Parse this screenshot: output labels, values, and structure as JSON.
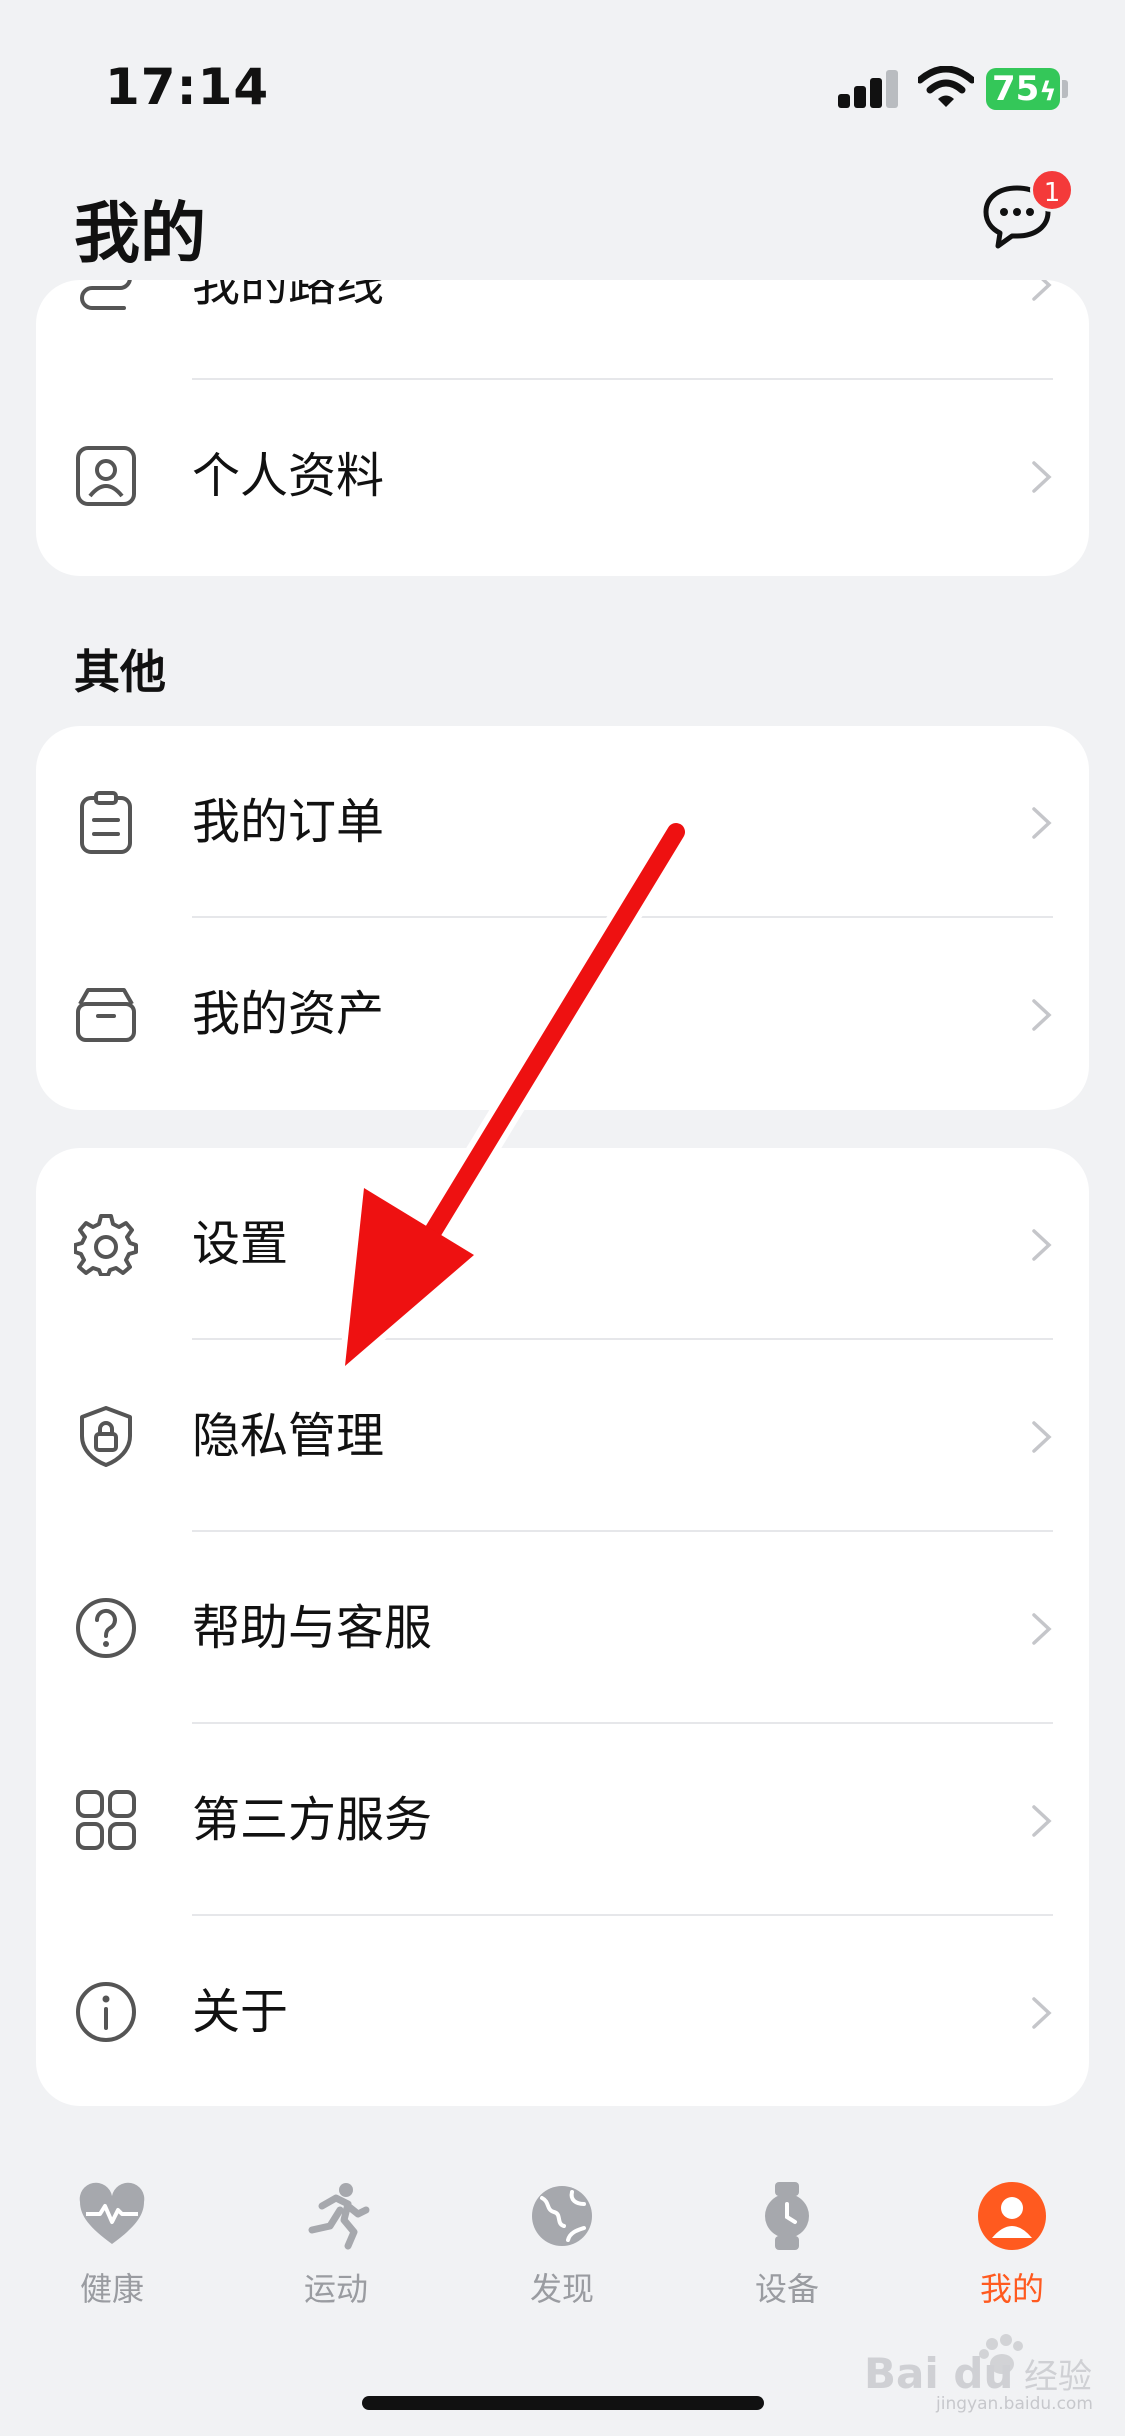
{
  "status_bar": {
    "time": "17:14",
    "battery": "75"
  },
  "header": {
    "title": "我的",
    "messages_badge": "1"
  },
  "card_top": {
    "items": [
      {
        "label": "我的路线",
        "icon": "route-icon"
      },
      {
        "label": "个人资料",
        "icon": "profile-icon"
      }
    ]
  },
  "section_other": {
    "title": "其他"
  },
  "card_other": {
    "items": [
      {
        "label": "我的订单",
        "icon": "clipboard-icon"
      },
      {
        "label": "我的资产",
        "icon": "box-icon"
      }
    ]
  },
  "card_settings": {
    "items": [
      {
        "label": "设置",
        "icon": "gear-icon"
      },
      {
        "label": "隐私管理",
        "icon": "shield-lock-icon"
      },
      {
        "label": "帮助与客服",
        "icon": "question-icon"
      },
      {
        "label": "第三方服务",
        "icon": "grid-icon"
      },
      {
        "label": "关于",
        "icon": "info-icon"
      }
    ]
  },
  "tabbar": {
    "tabs": [
      {
        "label": "健康",
        "icon": "heart-icon",
        "active": false
      },
      {
        "label": "运动",
        "icon": "runner-icon",
        "active": false
      },
      {
        "label": "发现",
        "icon": "globe-icon",
        "active": false
      },
      {
        "label": "设备",
        "icon": "watch-icon",
        "active": false
      },
      {
        "label": "我的",
        "icon": "avatar-icon",
        "active": true
      }
    ]
  },
  "colors": {
    "accent": "#ff5a1f",
    "badge": "#f43a3a",
    "battery": "#34c759",
    "annotation_arrow": "#ee1111"
  },
  "watermark": {
    "brand": "Bai du 经验",
    "url": "jingyan.baidu.com"
  }
}
